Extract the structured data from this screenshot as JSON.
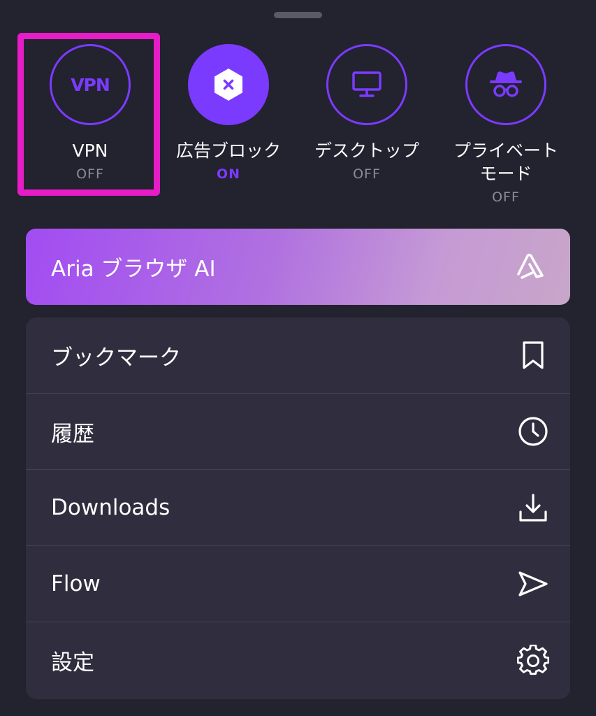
{
  "toggles": [
    {
      "label": "VPN",
      "state": "OFF",
      "icon": "vpn-icon",
      "icon_text": "VPN"
    },
    {
      "label": "広告ブロック",
      "state": "ON",
      "icon": "ad-block-icon"
    },
    {
      "label": "デスクトップ",
      "state": "OFF",
      "icon": "desktop-icon"
    },
    {
      "label": "プライベート\nモード",
      "state": "OFF",
      "icon": "incognito-icon"
    }
  ],
  "ai_banner": {
    "title": "Aria ブラウザ AI",
    "icon": "aria-logo-icon"
  },
  "menu": {
    "items": [
      {
        "label": "ブックマーク",
        "icon": "bookmark-icon"
      },
      {
        "label": "履歴",
        "icon": "clock-icon"
      },
      {
        "label": "Downloads",
        "icon": "download-icon"
      },
      {
        "label": "Flow",
        "icon": "send-icon"
      },
      {
        "label": "設定",
        "icon": "gear-icon"
      }
    ]
  },
  "colors": {
    "background": "#23222f",
    "accent": "#7b3bff",
    "highlight": "#e61cc7",
    "menu_bg": "#302e3e"
  }
}
